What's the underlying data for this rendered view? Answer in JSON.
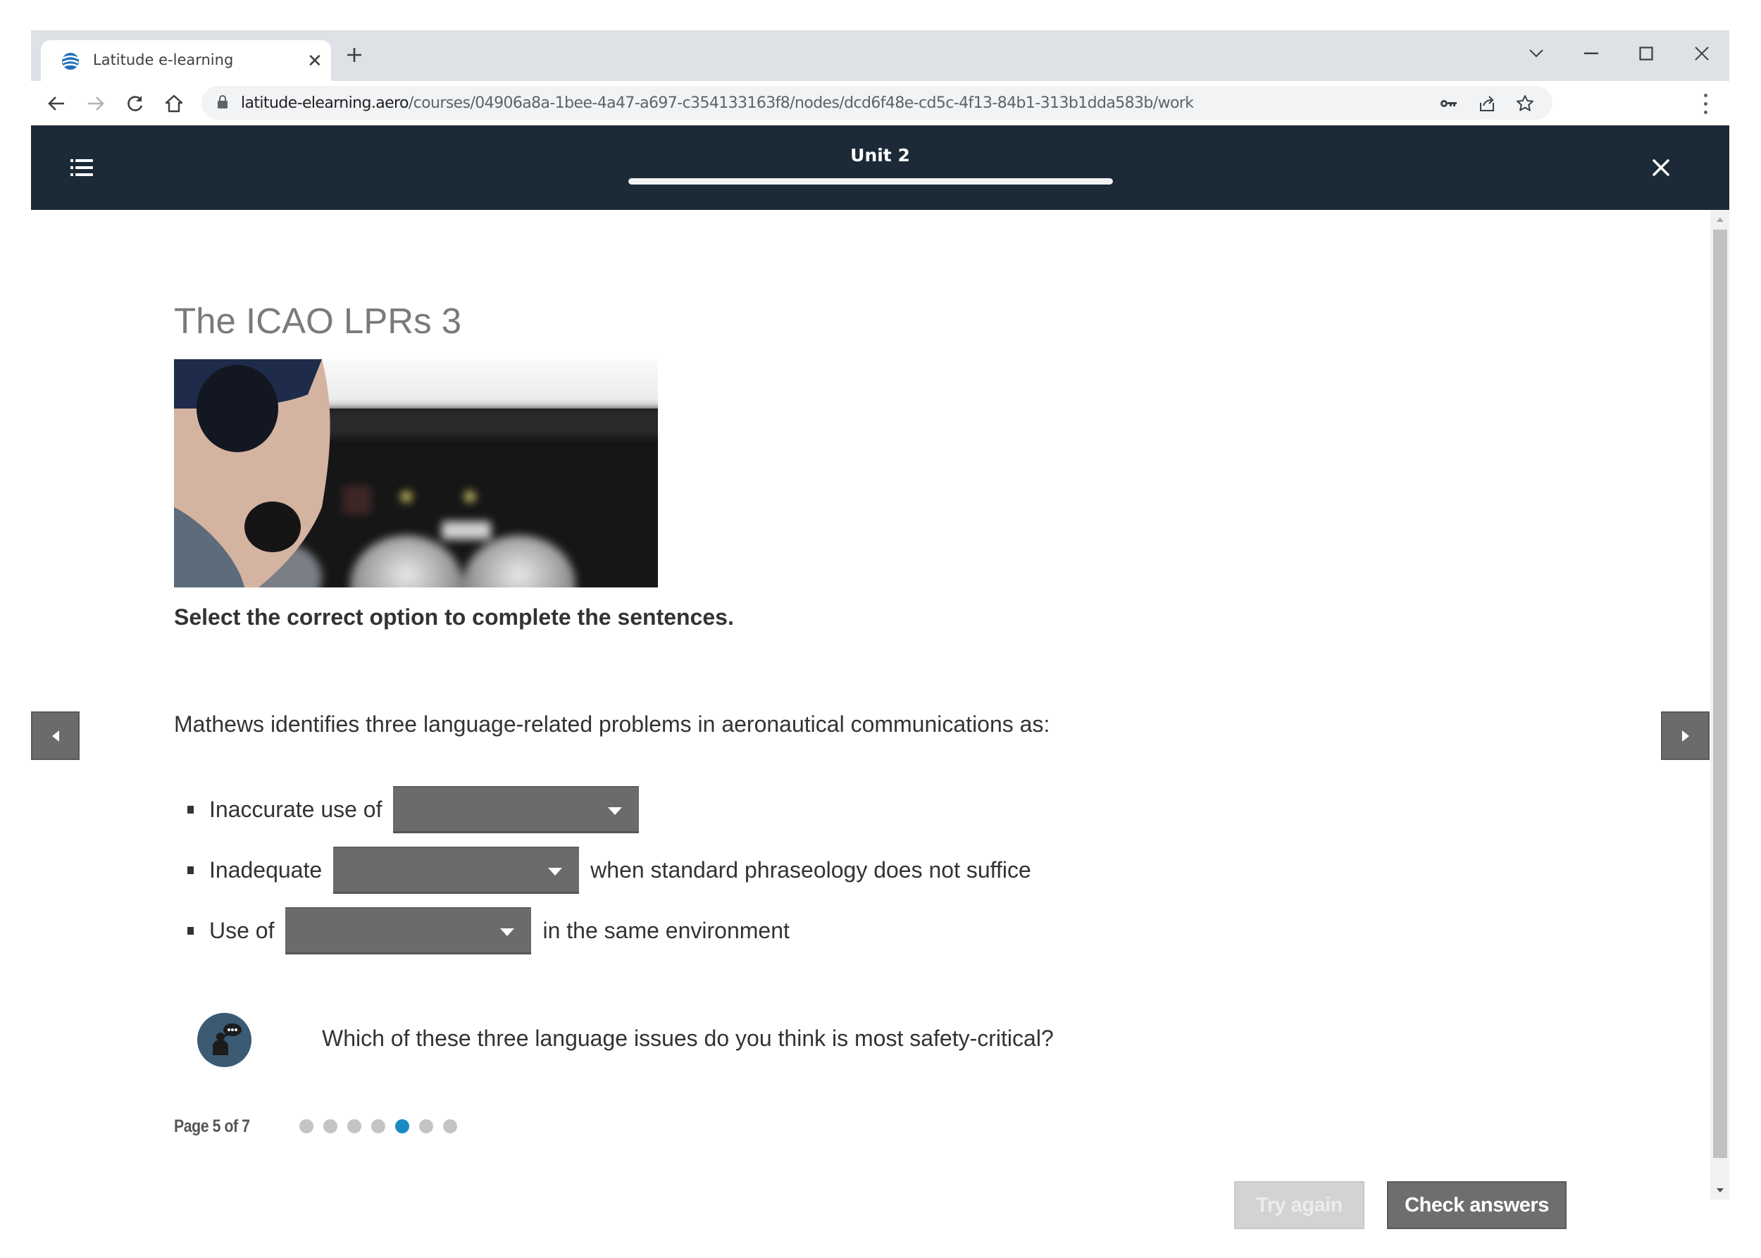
{
  "browser": {
    "tab": {
      "title": "Latitude e-learning",
      "favicon": "latitude-globe-icon",
      "close_icon": "close-icon"
    },
    "new_tab_icon": "plus-icon",
    "window_controls": [
      "chevron-down-icon",
      "minimize-icon",
      "maximize-icon",
      "close-icon"
    ],
    "address": {
      "host": "latitude-elearning.aero",
      "path": "/courses/04906a8a-1bee-4a47-a697-c354133163f8/nodes/dcd6f48e-cd5c-4f13-84b1-313b1dda583b/work"
    },
    "nav_icons": [
      "back-arrow-icon",
      "forward-arrow-icon",
      "reload-icon",
      "home-icon"
    ],
    "omnibox_icons": [
      "key-icon",
      "share-icon",
      "star-icon"
    ]
  },
  "app_header": {
    "menu_icon": "list-menu-icon",
    "title": "Unit 2",
    "progress": 1.0,
    "close_icon": "close-icon"
  },
  "page": {
    "title": "The ICAO LPRs 3",
    "image_alt": "Pilot wearing headset in cockpit",
    "instruction": "Select the correct option to complete the sentences.",
    "intro": "Mathews identifies three language-related problems in aeronautical communications as:",
    "items": [
      {
        "before": "Inaccurate use of",
        "selected": "",
        "after": ""
      },
      {
        "before": "Inadequate",
        "selected": "",
        "after": "when standard phraseology does not suffice"
      },
      {
        "before": "Use of",
        "selected": "",
        "after": "in the same environment"
      }
    ],
    "discussion_icon": "discussion-person-icon",
    "question": "Which of these three language issues do you think is most safety-critical?",
    "pagination": {
      "label": "Page 5 of 7",
      "current": 5,
      "total": 7
    },
    "buttons": {
      "try_again": "Try again",
      "check_answers": "Check answers"
    }
  },
  "colors": {
    "header_bg": "#1b2a36",
    "active_dot": "#1b8ac2",
    "inactive_dot": "#c4c4c4",
    "dropdown_bg": "#6b6b6b",
    "discussion_bg": "#3b5a73"
  }
}
